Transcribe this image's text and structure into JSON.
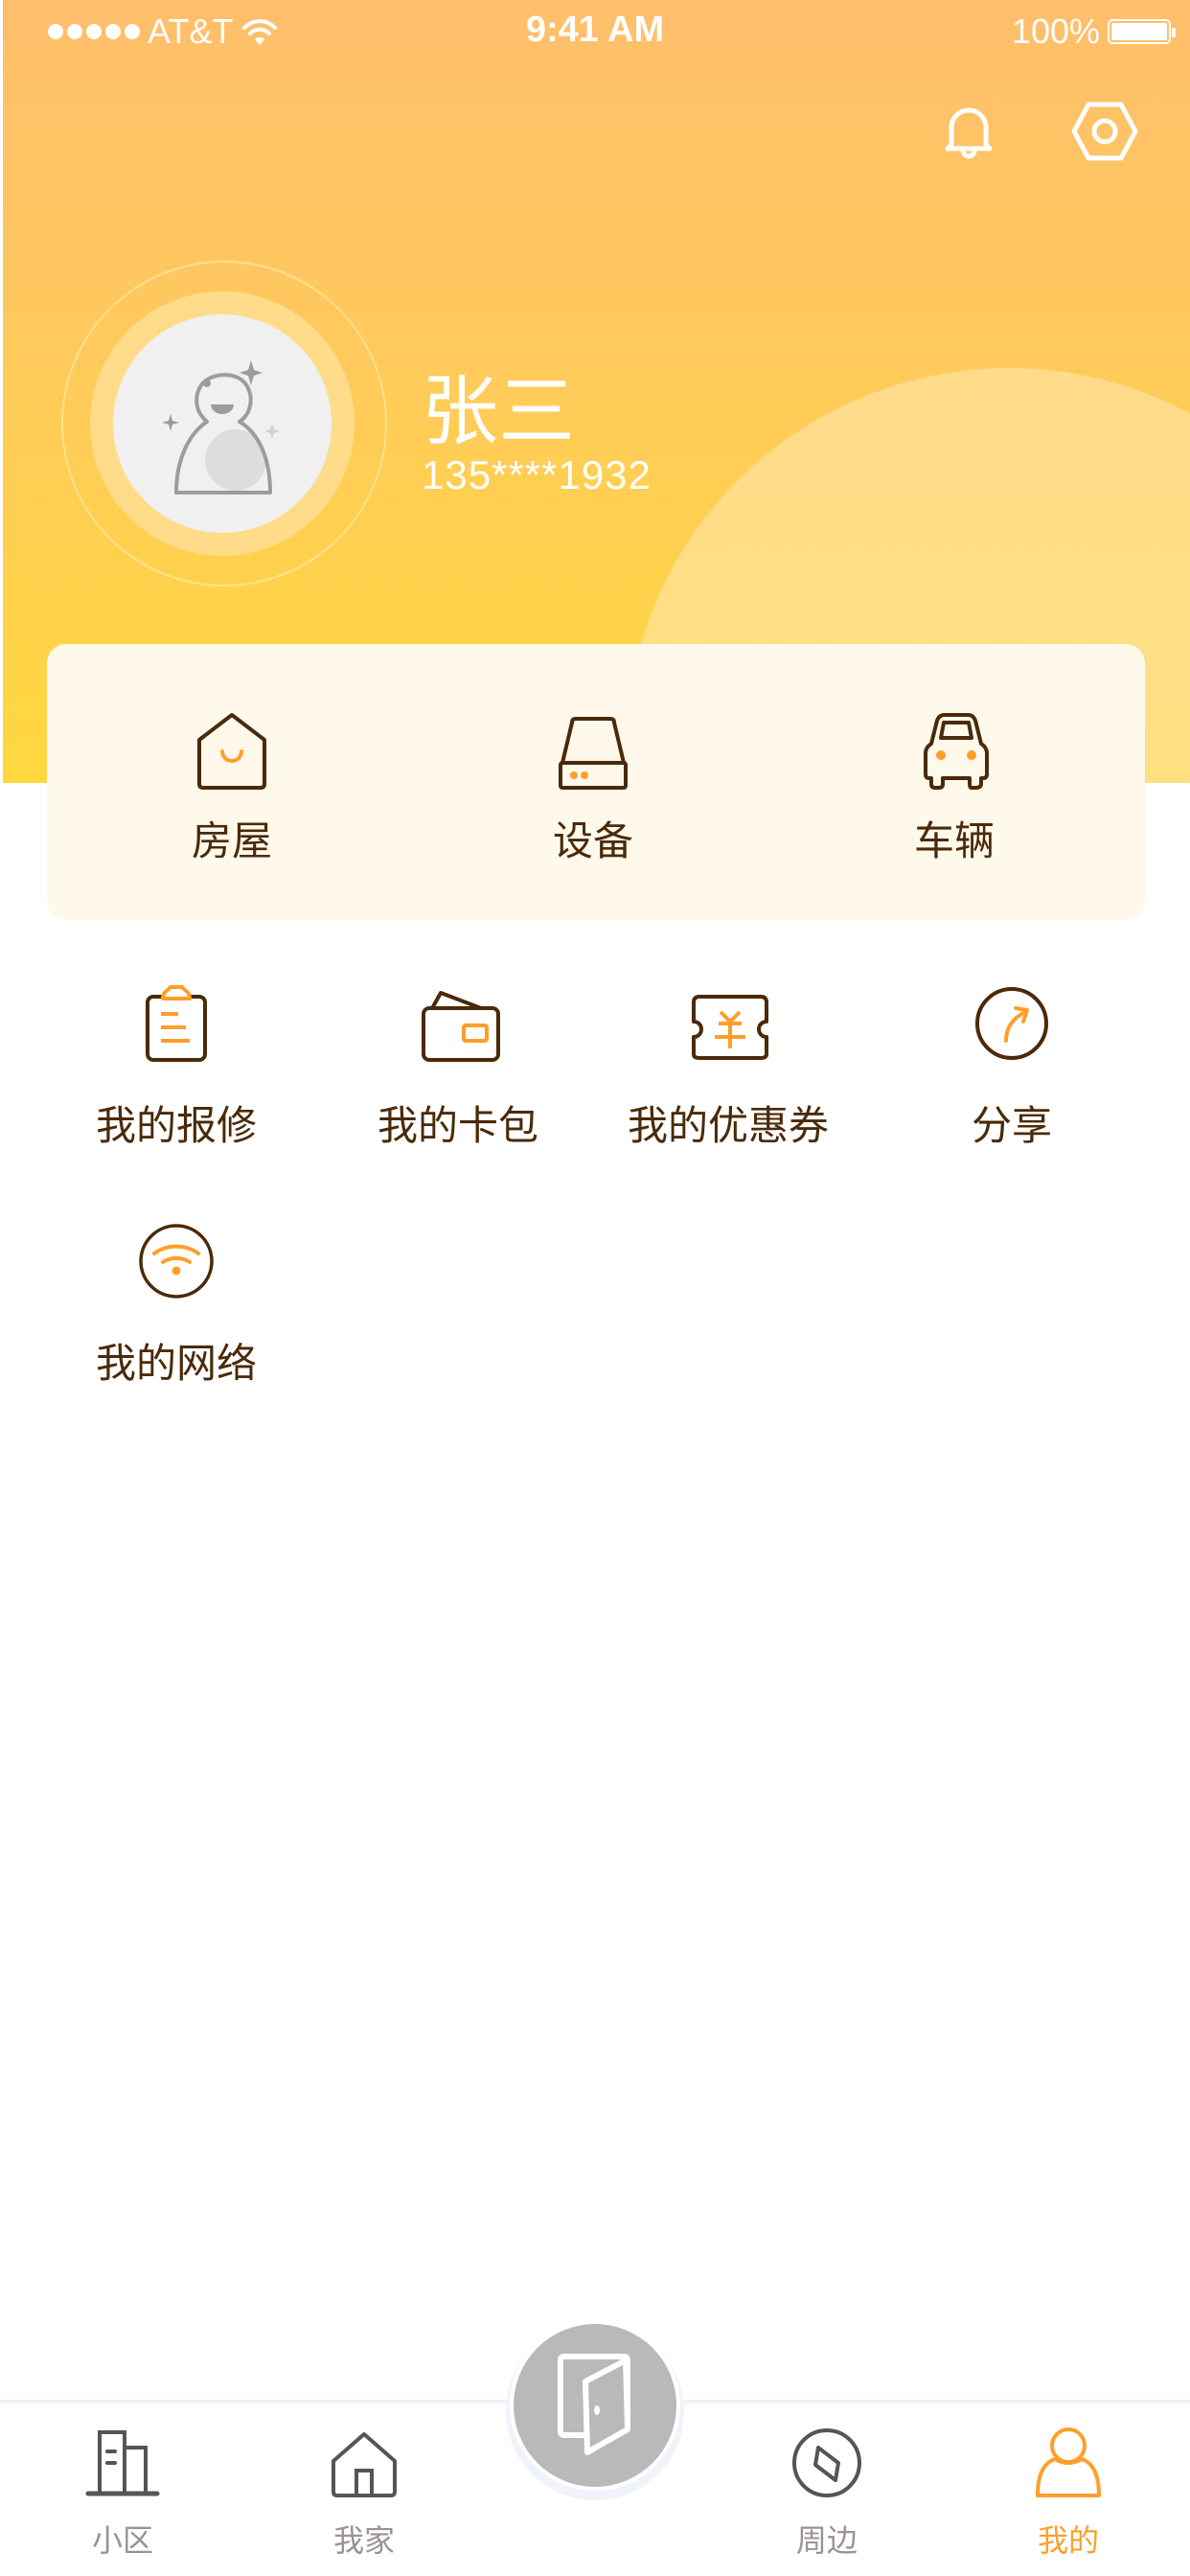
{
  "status_bar": {
    "carrier": "AT&T",
    "time": "9:41 AM",
    "battery": "100%"
  },
  "header": {
    "notification_icon": "bell-icon",
    "settings_icon": "hexagon-settings-icon"
  },
  "profile": {
    "name": "张三",
    "phone": "135****1932",
    "avatar_icon": "default-avatar-icon"
  },
  "quick_card": {
    "items": [
      {
        "label": "房屋",
        "icon": "house-icon"
      },
      {
        "label": "设备",
        "icon": "device-icon"
      },
      {
        "label": "车辆",
        "icon": "car-icon"
      }
    ]
  },
  "menu": {
    "items": [
      {
        "label": "我的报修",
        "icon": "clipboard-icon"
      },
      {
        "label": "我的卡包",
        "icon": "wallet-icon"
      },
      {
        "label": "我的优惠券",
        "icon": "coupon-icon"
      },
      {
        "label": "分享",
        "icon": "share-icon"
      },
      {
        "label": "我的网络",
        "icon": "wifi-icon"
      }
    ]
  },
  "tabbar": {
    "tabs": [
      {
        "label": "小区",
        "icon": "building-icon",
        "active": false
      },
      {
        "label": "我家",
        "icon": "home-icon",
        "active": false
      },
      {
        "label": "周边",
        "icon": "compass-icon",
        "active": false
      },
      {
        "label": "我的",
        "icon": "person-icon",
        "active": true
      }
    ],
    "center_icon": "door-icon"
  },
  "colors": {
    "accent": "#FF9F2A",
    "text_brown": "#4A2A08",
    "header_top": "#FFBE6C",
    "header_bottom": "#FFD83E",
    "card_bg": "#FFF9EC",
    "tab_inactive": "#9A9390",
    "center_button": "#B9B9B9"
  }
}
